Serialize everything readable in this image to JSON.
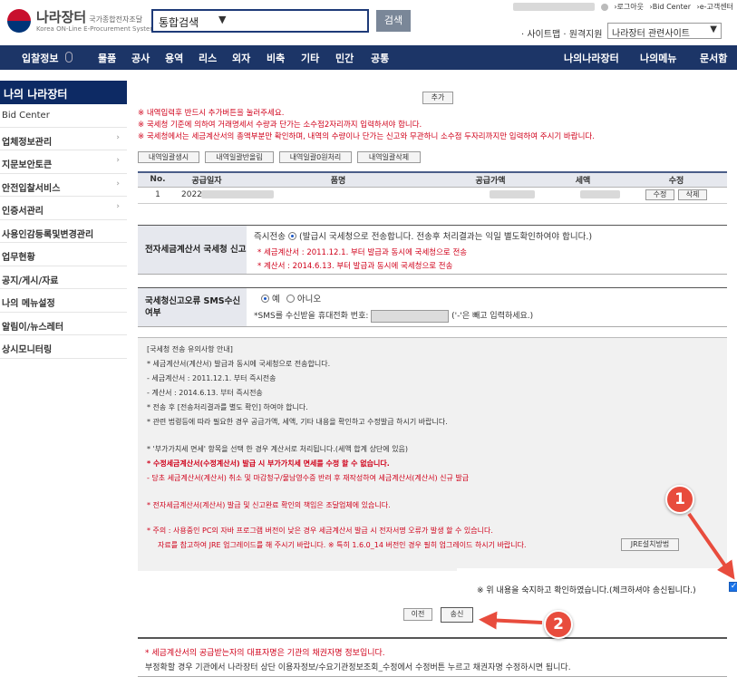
{
  "header": {
    "logo_name": "나라장터",
    "logo_sub": "국가종합전자조달",
    "logo_en": "Korea ON-Line E-Procurement System",
    "search_select": "통합검색",
    "search_button": "검색",
    "top_links": [
      "›로그아웃",
      "›Bid Center",
      "›e-고객센터"
    ],
    "site_links": "· 사이트맵 · 원격지원",
    "related_select": "나라장터 관련사이트"
  },
  "nav": {
    "left": [
      "입찰정보",
      "물품",
      "공사",
      "용역",
      "리스",
      "외자",
      "비축",
      "기타",
      "민간",
      "공통"
    ],
    "right": [
      "나의나라장터",
      "나의메뉴",
      "문서함"
    ]
  },
  "sidebar": {
    "title": "나의 나라장터",
    "items": [
      "Bid Center",
      "업체정보관리",
      "지문보안토큰",
      "안전입찰서비스",
      "인증서관리",
      "사용인감등록및변경관리",
      "업무현황",
      "공지/게시/자료",
      "나의 메뉴설정",
      "알림이/뉴스레터",
      "상시모니터링"
    ]
  },
  "content": {
    "add_button": "추가",
    "notes": [
      "※ 내역입력후 반드시 추가버튼을 눌러주세요.",
      "※ 국세청 기준에 의하여 거래명세서 수량과 단가는 소수점2자리까지 입력하셔야 합니다.",
      "※ 국세청에서는 세금계산서의 총액부분만 확인하며, 내역의 수량이나 단가는 신고와 무관하니 소수점 두자리까지만 입력하여 주시기 바랍니다."
    ],
    "row_buttons": [
      "내역일괄생시",
      "내역일괄반올림",
      "내역일괄0원처리",
      "내역일괄삭제"
    ],
    "table": {
      "headers": [
        "No.",
        "공급일자",
        "품명",
        "공급가액",
        "세액",
        "수정"
      ],
      "rows": [
        {
          "no": "1",
          "date": "2022/",
          "edit": "수정",
          "delete": "삭제"
        }
      ]
    },
    "efile": {
      "label": "전자세금계산서 국세청 신고",
      "option": "즉시전송",
      "desc": "(발급시 국세청으로 전송합니다. 전송후 처리결과는 익일 별도확인하여야 합니다.)",
      "line1": "* 세금계산서 : 2011.12.1. 부터 발급과 동시에 국세청으로 전송",
      "line2": "* 계산서 : 2014.6.13. 부터 발급과 동시에 국세청으로 전송"
    },
    "sms": {
      "label": "국세청신고오류 SMS수신여부",
      "yes": "예",
      "no": "아니오",
      "phone_label": "*SMS를 수신받을 휴대전화 번호:",
      "phone_hint": "('-'은 빼고 입력하세요.)"
    },
    "info_lines": [
      "[국세청 전송 유의사항 안내]",
      "* 세금계산서(계산서) 발급과 동시에 국세청으로 전송합니다.",
      "- 세금계산서 : 2011.12.1. 부터 즉시전송",
      "- 계산서 : 2014.6.13. 부터 즉시전송",
      "* 전송 후 [전송처리결과를 별도 확인] 하여야 합니다.",
      "* 관련 법령등에 따라 필요한 경우 공급가액, 세액, 기타 내용을 확인하고 수정발급 하시기 바랍니다.",
      "* '부가가치세 면세' 항목을 선택 한 경우 계산서로 처리됩니다.(세액 합계 상단에 있음)",
      "* 수정세금계산서(수정계산서) 발급 시 부가가치세 면세를 수정 할 수 없습니다.",
      "- 당초 세금계산서(계산서) 취소 및 마감청구/물남영수증 반려 후 재작성하여 세금계산서(계산서) 신규 발급",
      "* 전자세금계산서(계산서) 발급 및 신고완료 확인의 책임은 조달업체에 있습니다.",
      "* 주의 : 사용중인 PC의 자바 프로그램 버전이 낮은 경우 세금계산서 발급 시 전자서명 오류가 발생 할 수 있습니다.",
      "자료를 참고하여 JRE 업그레이드를 해 주시기 바랍니다. ※ 특히 1.6.0_14 버전인 경우 필히 업그레이드 하시기 바랍니다."
    ],
    "jre_button": "JRE설치방법",
    "agree_text": "※ 위 내용을 숙지하고 확인하였습니다.(체크하셔야 송신됩니다.)",
    "prev_button": "이전",
    "send_button": "송신",
    "footer": [
      "* 세금계산서의 공급받는자의 대표자명은 기관의 채권자명 정보입니다.",
      "부정확할 경우 기관에서 나라장터 상단 이용자정보/수요기관정보조회_수정에서 수정버튼 누르고 채권자명 수정하시면 됩니다."
    ],
    "badges": [
      "1",
      "2"
    ]
  },
  "colors": {
    "nav": "#1c3567",
    "sidebar_header": "#0d2a64",
    "accent_red": "#d0021b",
    "badge": "#e84c3d",
    "checkbox": "#1a73e8"
  }
}
